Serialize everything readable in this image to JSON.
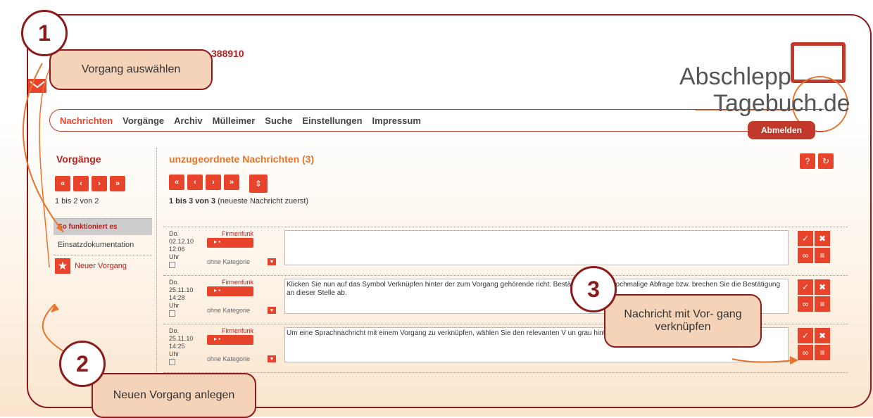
{
  "header": {
    "case_id": "388910",
    "logout_label": "Abmelden"
  },
  "logo": {
    "line1": "Abschlepp",
    "line2": "Tagebuch.de"
  },
  "nav": {
    "items": [
      "Nachrichten",
      "Vorgänge",
      "Archiv",
      "Mülleimer",
      "Suche",
      "Einstellungen",
      "Impressum"
    ],
    "active": "Nachrichten"
  },
  "sidebar": {
    "title": "Vorgänge",
    "count": "1 bis 2 von 2",
    "menu_active": "So funktioniert es",
    "menu_item": "Einsatzdokumentation",
    "new_case": "Neuer Vorgang"
  },
  "main": {
    "title": "unzugeordnete Nachrichten (3)",
    "count_bold": "1 bis 3 von 3",
    "count_rest": "(neueste Nachricht zuerst)",
    "rows": [
      {
        "day": "Do.",
        "date": "02.12.10",
        "time": "12:06",
        "suffix": "Uhr",
        "sender": "Firmenfunk",
        "category": "ohne Kategorie",
        "text": ""
      },
      {
        "day": "Do.",
        "date": "25.11.10",
        "time": "14:28",
        "suffix": "Uhr",
        "sender": "Firmenfunk",
        "category": "ohne Kategorie",
        "text": "Klicken Sie nun auf das Symbol Verknüpfen hinter der zum Vorgang gehörende                      richt. Bestätigen Sie die nochmalige Abfrage bzw. brechen Sie die Bestätigung an dieser Stelle ab."
      },
      {
        "day": "Do.",
        "date": "25.11.10",
        "time": "14:25",
        "suffix": "Uhr",
        "sender": "Firmenfunk",
        "category": "ohne Kategorie",
        "text": "Um eine Sprachnachricht mit einem Vorgang zu verknüpfen, wählen Sie den relevanten V                                                                      un grau hinterlegt."
      }
    ]
  },
  "callouts": [
    {
      "number": "1",
      "text": "Vorgang auswählen"
    },
    {
      "number": "2",
      "text": "Neuen Vorgang anlegen"
    },
    {
      "number": "3",
      "text": "Nachricht mit Vor- gang verknüpfen"
    }
  ],
  "colors": {
    "accent": "#e8442c",
    "dark_red": "#8b1a1a",
    "callout_bg": "#f4d3b8"
  }
}
